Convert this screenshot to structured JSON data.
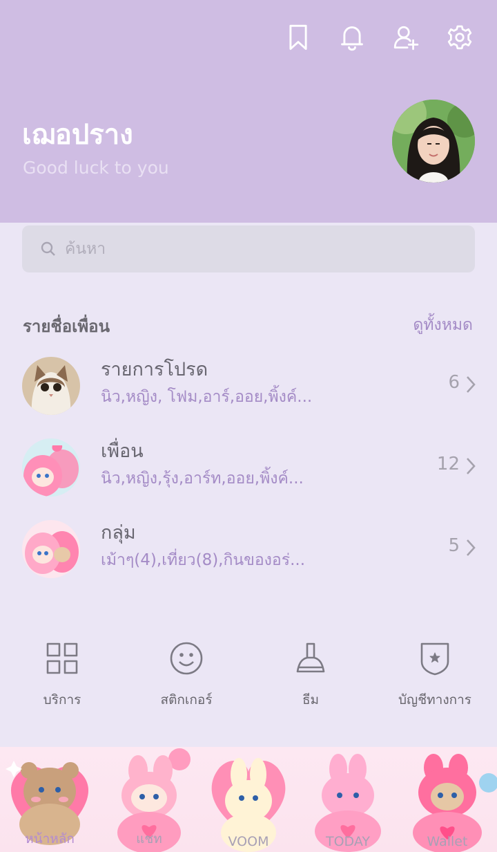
{
  "header": {
    "icons": [
      "bookmark-icon",
      "bell-icon",
      "add-friend-icon",
      "settings-icon"
    ],
    "profile_name": "เฌอปราง",
    "status_message": "Good luck to you"
  },
  "search": {
    "placeholder": "ค้นหา"
  },
  "friends_section": {
    "title": "รายชื่อเพื่อน",
    "see_all": "ดูทั้งหมด",
    "rows": [
      {
        "title": "รายการโปรด",
        "subtitle": "นิว,หญิง, โฟม,อาร์,ออย,พิ้งค์...",
        "count": "6"
      },
      {
        "title": "เพื่อน",
        "subtitle": "นิว,หญิง,รุ้ง,อาร์ท,ออย,พิ้งค์...",
        "count": "12"
      },
      {
        "title": "กลุ่ม",
        "subtitle": "เม้าๆ(4),เที่ยว(8),กินของอร่...",
        "count": "5"
      }
    ]
  },
  "services": [
    {
      "label": "บริการ",
      "icon": "grid-icon"
    },
    {
      "label": "สติกเกอร์",
      "icon": "smiley-icon"
    },
    {
      "label": "ธีม",
      "icon": "brush-icon"
    },
    {
      "label": "บัญชีทางการ",
      "icon": "shield-star-icon"
    }
  ],
  "bottom_nav": [
    {
      "label": "หน้าหลัก",
      "active": true
    },
    {
      "label": "แชท",
      "active": false
    },
    {
      "label": "VOOM",
      "active": false
    },
    {
      "label": "TODAY",
      "active": false
    },
    {
      "label": "Wallet",
      "active": false
    }
  ],
  "colors": {
    "header_bg": "#cfbde3",
    "page_bg": "#ebe6f5",
    "accent": "#a48bc6"
  }
}
